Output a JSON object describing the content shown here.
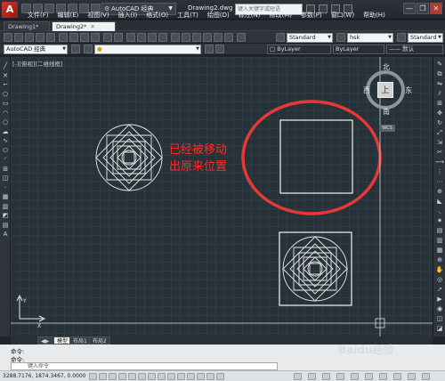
{
  "window": {
    "app_logo": "A",
    "workspace": "AutoCAD 经典",
    "document_title": "Drawing2.dwg",
    "search_placeholder": "键入关键字或短语",
    "close": "✕",
    "minimize": "—",
    "restore": "❐"
  },
  "menu": [
    "文件(F)",
    "编辑(E)",
    "视图(V)",
    "插入(I)",
    "格式(O)",
    "工具(T)",
    "绘图(D)",
    "标注(N)",
    "修改(M)",
    "参数(P)",
    "窗口(W)",
    "帮助(H)"
  ],
  "tabs": [
    {
      "label": "Drawing1*",
      "active": false
    },
    {
      "label": "Drawing2*",
      "active": true
    }
  ],
  "toolbar1": {
    "text_style": "Standard",
    "dim_style": "hsk",
    "table_style": "Standard"
  },
  "toolbar2": {
    "workspace": "AutoCAD 经典",
    "layer_color": "ByLayer",
    "linetype": "ByLayer",
    "lineweight": "—— 默认"
  },
  "viewport": {
    "label": "[-][俯视][二维线框]"
  },
  "viewcube": {
    "north": "北",
    "south": "南",
    "west": "西",
    "east": "东",
    "face": "上",
    "wcs": "WCS"
  },
  "annotation": {
    "line1": "已经被移动",
    "line2": "出原来位置"
  },
  "layout_tabs": [
    {
      "label": "模型",
      "active": true
    },
    {
      "label": "布局1",
      "active": false
    },
    {
      "label": "布局2",
      "active": false
    }
  ],
  "command": {
    "history1": "命令:",
    "history2": "命令:",
    "placeholder": "键入命令"
  },
  "status": {
    "coords": "3288.7176, 1874.3467, 0.0000"
  },
  "watermark": "Baidu经验",
  "colors": {
    "canvas": "#263238",
    "geometry": "#f2f2f2",
    "annotation": "#ff2a2a",
    "circle_highlight": "#e53935"
  }
}
